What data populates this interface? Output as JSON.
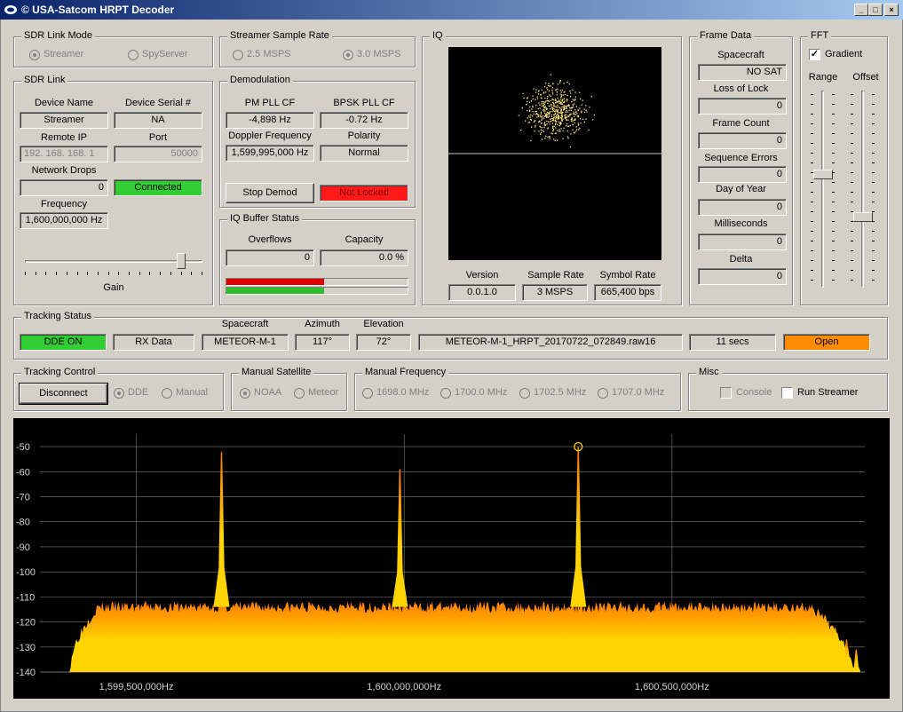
{
  "window": {
    "title": "© USA-Satcom HRPT Decoder",
    "icon": "satellite-dish-icon"
  },
  "sdr_link_mode": {
    "title": "SDR Link Mode",
    "options": [
      "Streamer",
      "SpyServer"
    ],
    "selected": "Streamer"
  },
  "streamer_sample_rate": {
    "title": "Streamer Sample Rate",
    "options": [
      "2.5 MSPS",
      "3.0 MSPS"
    ],
    "selected": "3.0 MSPS"
  },
  "sdr_link": {
    "title": "SDR Link",
    "device_name_label": "Device Name",
    "device_name": "Streamer",
    "device_serial_label": "Device Serial #",
    "device_serial": "NA",
    "remote_ip_label": "Remote IP",
    "remote_ip": "192. 168. 168. 1",
    "port_label": "Port",
    "port": "50000",
    "network_drops_label": "Network Drops",
    "network_drops": "0",
    "status": "Connected",
    "frequency_label": "Frequency",
    "frequency": "1,600,000,000 Hz",
    "gain_label": "Gain",
    "gain_level": 0.9
  },
  "demodulation": {
    "title": "Demodulation",
    "pm_pll_label": "PM PLL CF",
    "pm_pll": "-4,898 Hz",
    "bpsk_pll_label": "BPSK PLL CF",
    "bpsk_pll": "-0.72 Hz",
    "doppler_label": "Doppler Frequency",
    "doppler": "1,599,995,000 Hz",
    "polarity_label": "Polarity",
    "polarity": "Normal",
    "stop_button": "Stop Demod",
    "lock_status": "Not Locked"
  },
  "iq_buffer": {
    "title": "IQ Buffer Status",
    "overflows_label": "Overflows",
    "overflows": "0",
    "capacity_label": "Capacity",
    "capacity": "0.0 %",
    "bar1_fill": 0.54,
    "bar2_fill": 0.54
  },
  "iq": {
    "title": "IQ",
    "version_label": "Version",
    "version": "0.0.1.0",
    "sample_rate_label": "Sample Rate",
    "sample_rate": "3 MSPS",
    "symbol_rate_label": "Symbol Rate",
    "symbol_rate": "665,400 bps"
  },
  "frame_data": {
    "title": "Frame Data",
    "spacecraft_label": "Spacecraft",
    "spacecraft": "NO SAT",
    "loss_of_lock_label": "Loss of Lock",
    "loss_of_lock": "0",
    "frame_count_label": "Frame Count",
    "frame_count": "0",
    "sequence_errors_label": "Sequence Errors",
    "sequence_errors": "0",
    "day_of_year_label": "Day of Year",
    "day_of_year": "0",
    "milliseconds_label": "Milliseconds",
    "milliseconds": "0",
    "delta_label": "Delta",
    "delta": "0"
  },
  "fft_panel": {
    "title": "FFT",
    "gradient_label": "Gradient",
    "gradient_checked": true,
    "range_label": "Range",
    "offset_label": "Offset",
    "range_level": 0.58,
    "offset_level": 0.35
  },
  "tracking_status": {
    "title": "Tracking Status",
    "dde": "DDE ON",
    "rx": "RX Data",
    "spacecraft_label": "Spacecraft",
    "spacecraft": "METEOR-M-1",
    "azimuth_label": "Azimuth",
    "azimuth": "117°",
    "elevation_label": "Elevation",
    "elevation": "72°",
    "filename": "METEOR-M-1_HRPT_20170722_072849.raw16",
    "elapsed": "11 secs",
    "open_button": "Open"
  },
  "tracking_control": {
    "title": "Tracking Control",
    "disconnect_button": "Disconnect",
    "options": [
      "DDE",
      "Manual"
    ],
    "selected": "DDE"
  },
  "manual_satellite": {
    "title": "Manual Satellite",
    "options": [
      "NOAA",
      "Meteor"
    ],
    "selected": "NOAA"
  },
  "manual_frequency": {
    "title": "Manual Frequency",
    "options": [
      "1698.0 MHz",
      "1700.0 MHz",
      "1702.5 MHz",
      "1707.0 MHz"
    ]
  },
  "misc": {
    "title": "Misc",
    "console_label": "Console",
    "run_streamer_label": "Run Streamer"
  },
  "chart_data": {
    "type": "area",
    "ylim": [
      -140,
      -45
    ],
    "xlim": [
      1599320000,
      1600860000
    ],
    "yticks": [
      -50,
      -60,
      -70,
      -80,
      -90,
      -100,
      -110,
      -120,
      -130,
      -140
    ],
    "xticks": [
      {
        "value": 1599500000,
        "label": "1,599,500,000Hz"
      },
      {
        "value": 1600000000,
        "label": "1,600,000,000Hz"
      },
      {
        "value": 1600500000,
        "label": "1,600,500,000Hz"
      }
    ],
    "noise_floor_db": -114,
    "band_edges": [
      1599376000,
      1600840000
    ],
    "peaks": [
      {
        "x": 1599659000,
        "y": -52
      },
      {
        "x": 1599992000,
        "y": -59
      },
      {
        "x": 1600325000,
        "y": -50
      }
    ],
    "spurs": [
      {
        "x": 1600826000,
        "y": -127
      },
      {
        "x": 1600844000,
        "y": -131
      }
    ],
    "marker": {
      "x": 1600325000,
      "y": -50
    },
    "colors": {
      "fill_top": "#ff7a00",
      "fill_bottom": "#ffd400",
      "grid": "#808080",
      "marker": "#ffd400"
    }
  }
}
